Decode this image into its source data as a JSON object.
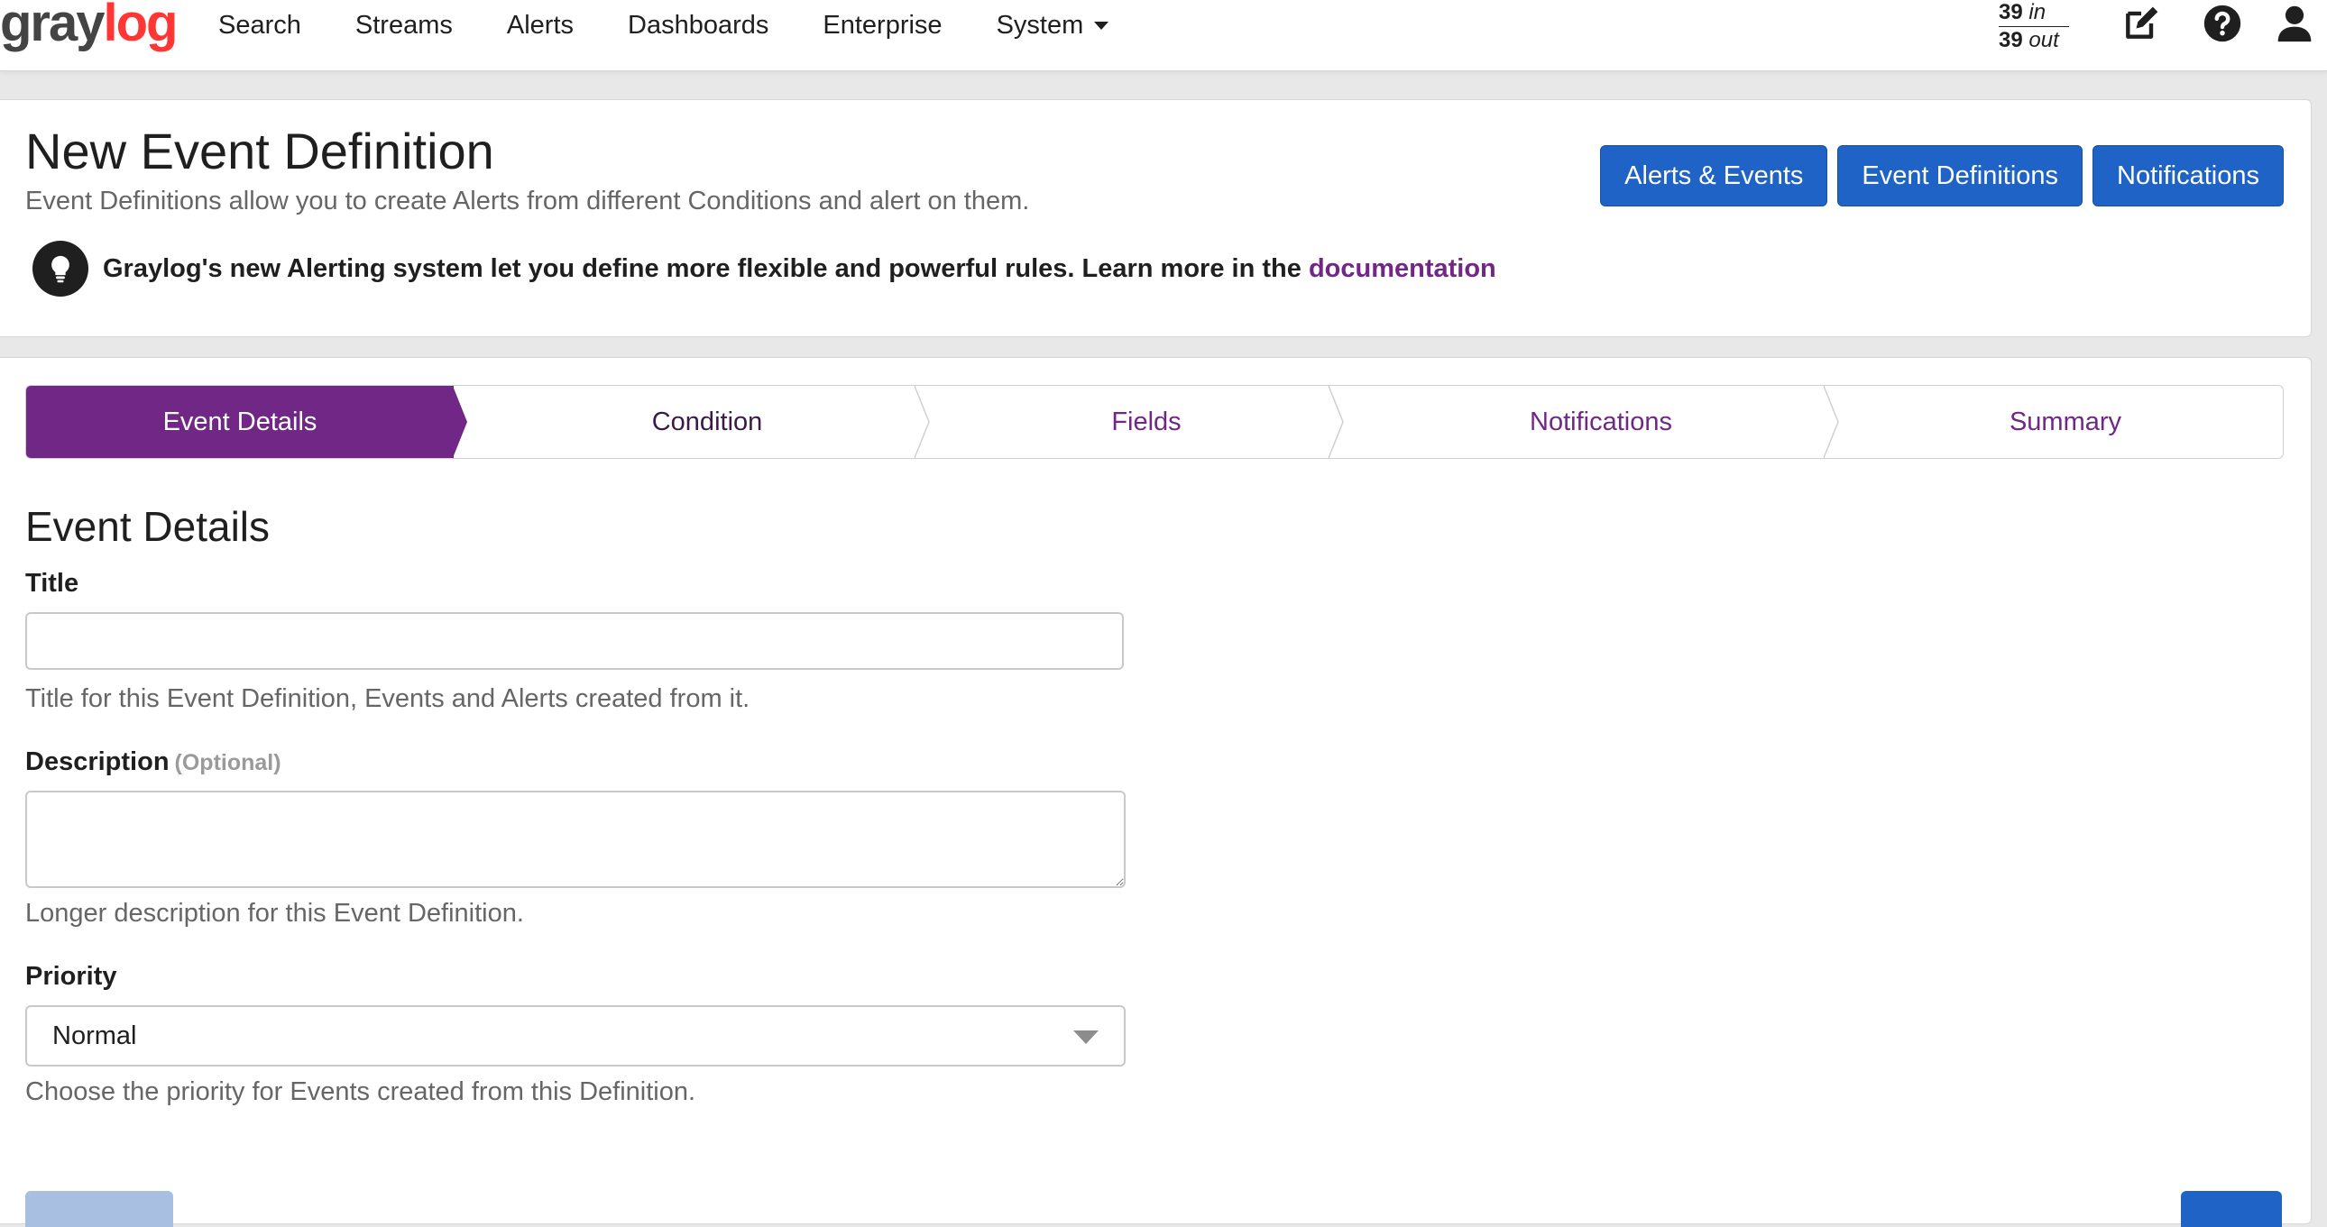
{
  "navbar": {
    "logo_part1": "gray",
    "logo_part2": "log",
    "links": [
      "Search",
      "Streams",
      "Alerts",
      "Dashboards",
      "Enterprise",
      "System"
    ],
    "throughput": {
      "in_count": "39",
      "in_label": "in",
      "out_count": "39",
      "out_label": "out"
    },
    "icons": [
      "edit-icon",
      "help-icon",
      "user-icon"
    ]
  },
  "header": {
    "title": "New Event Definition",
    "subtitle": "Event Definitions allow you to create Alerts from different Conditions and alert on them.",
    "hint_text": "Graylog's new Alerting system let you define more flexible and powerful rules. Learn more in the",
    "hint_link": "documentation",
    "buttons": [
      "Alerts & Events",
      "Event Definitions",
      "Notifications"
    ]
  },
  "wizard": {
    "steps": [
      "Event Details",
      "Condition",
      "Fields",
      "Notifications",
      "Summary"
    ],
    "active_step": "Event Details",
    "section_title": "Event Details",
    "title_field": {
      "label": "Title",
      "value": "",
      "help": "Title for this Event Definition, Events and Alerts created from it."
    },
    "description_field": {
      "label": "Description",
      "optional": "(Optional)",
      "value": "",
      "help": "Longer description for this Event Definition."
    },
    "priority_field": {
      "label": "Priority",
      "value": "Normal",
      "help": "Choose the priority for Events created from this Definition."
    }
  },
  "colors": {
    "primary": "#1e63c5",
    "accent": "#702785",
    "logo_red": "#ff3633"
  }
}
